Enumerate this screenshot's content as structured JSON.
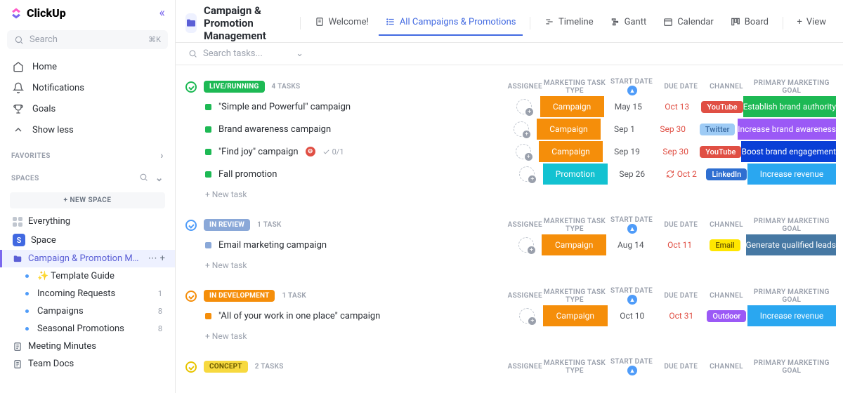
{
  "app": {
    "name": "ClickUp"
  },
  "sidebar": {
    "search_placeholder": "Search",
    "search_kbd": "⌘K",
    "nav": [
      "Home",
      "Notifications",
      "Goals",
      "Show less"
    ],
    "favorites_label": "FAVORITES",
    "spaces_label": "SPACES",
    "new_space": "+  NEW SPACE",
    "everything": "Everything",
    "space": "Space",
    "space_initial": "S",
    "folder": "Campaign & Promotion M…",
    "lists": [
      {
        "label": "✨ Template Guide",
        "count": ""
      },
      {
        "label": "Incoming Requests",
        "count": "1"
      },
      {
        "label": "Campaigns",
        "count": "8"
      },
      {
        "label": "Seasonal Promotions",
        "count": "8"
      }
    ],
    "docs": [
      "Meeting Minutes",
      "Team Docs"
    ]
  },
  "header": {
    "title": "Campaign & Promotion Management",
    "tabs": [
      "Welcome!",
      "All Campaigns & Promotions",
      "Timeline",
      "Gantt",
      "Calendar",
      "Board"
    ],
    "view_btn": "View",
    "search_placeholder": "Search tasks..."
  },
  "columns": {
    "assignee": "ASSIGNEE",
    "type": "MARKETING TASK TYPE",
    "start": "START DATE",
    "due": "DUE DATE",
    "channel": "CHANNEL",
    "goal": "PRIMARY MARKETING GOAL"
  },
  "new_task_label": "+ New task",
  "groups": [
    {
      "status": "LIVE/RUNNING",
      "status_color": "#1db954",
      "toggle_color": "#1db954",
      "count": "4 TASKS",
      "tasks": [
        {
          "sq": "#1db954",
          "title": "\"Simple and Powerful\" campaign",
          "type": "Campaign",
          "type_color": "#f58e0a",
          "start": "May 15",
          "due": "Oct 13",
          "due_red": true,
          "channel": "YouTube",
          "channel_bg": "#e04f44",
          "goal": "Establish brand authority",
          "goal_bg": "#1db954"
        },
        {
          "sq": "#1db954",
          "title": "Brand awareness campaign",
          "type": "Campaign",
          "type_color": "#f58e0a",
          "start": "Sep 1",
          "due": "Sep 30",
          "due_red": true,
          "channel": "Twitter",
          "channel_bg": "#9ecbf5",
          "channel_fg": "#3a6aa0",
          "goal": "Increase brand awareness",
          "goal_bg": "#9b59f6"
        },
        {
          "sq": "#1db954",
          "title": "\"Find joy\" campaign",
          "blocked": true,
          "sub": "0/1",
          "type": "Campaign",
          "type_color": "#f58e0a",
          "start": "Sep 19",
          "due": "Sep 30",
          "due_red": true,
          "channel": "YouTube",
          "channel_bg": "#e04f44",
          "goal": "Boost brand engagement",
          "goal_bg": "#0a3fd6"
        },
        {
          "sq": "#1db954",
          "title": "Fall promotion",
          "type": "Promotion",
          "type_color": "#13c2d1",
          "start": "Sep 26",
          "due": "Oct 2",
          "due_red": true,
          "due_recurring": true,
          "channel": "LinkedIn",
          "channel_bg": "#2f6fd1",
          "goal": "Increase revenue",
          "goal_bg": "#2aa7f0"
        }
      ]
    },
    {
      "status": "IN REVIEW",
      "status_color": "#8aa8d8",
      "toggle_color": "#4f9cf9",
      "count": "1 TASK",
      "tasks": [
        {
          "sq": "#8aa8d8",
          "title": "Email marketing campaign",
          "type": "Campaign",
          "type_color": "#f58e0a",
          "start": "Aug 14",
          "due": "Oct 11",
          "due_red": true,
          "channel": "Email",
          "channel_bg": "#ffe600",
          "channel_fg": "#6b5a00",
          "goal": "Generate qualified leads",
          "goal_bg": "#4678a3"
        }
      ]
    },
    {
      "status": "IN DEVELOPMENT",
      "status_color": "#f58e0a",
      "toggle_color": "#f58e0a",
      "count": "1 TASK",
      "tasks": [
        {
          "sq": "#f58e0a",
          "title": "\"All of your work in one place\" campaign",
          "type": "Campaign",
          "type_color": "#f58e0a",
          "start": "Oct 10",
          "due": "Oct 31",
          "due_red": true,
          "channel": "Outdoor",
          "channel_bg": "#9b59f6",
          "goal": "Increase revenue",
          "goal_bg": "#2aa7f0"
        }
      ]
    },
    {
      "status": "CONCEPT",
      "status_color": "#f7d93f",
      "status_fg": "#6b5a00",
      "toggle_color": "#e8c400",
      "count": "2 TASKS",
      "tasks": []
    }
  ]
}
